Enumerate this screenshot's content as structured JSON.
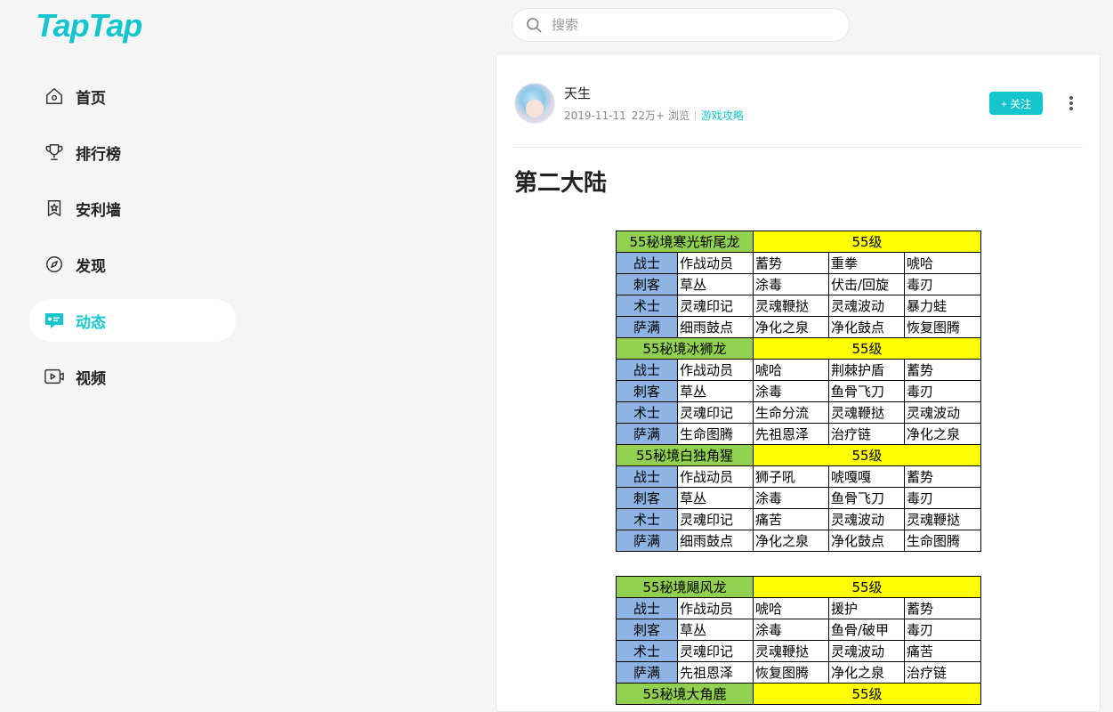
{
  "app": {
    "logo": "TapTap"
  },
  "nav": {
    "items": [
      {
        "label": "首页",
        "icon": "home-icon"
      },
      {
        "label": "排行榜",
        "icon": "trophy-icon"
      },
      {
        "label": "安利墙",
        "icon": "badge-icon"
      },
      {
        "label": "发现",
        "icon": "compass-icon"
      },
      {
        "label": "动态",
        "icon": "message-icon",
        "active": true
      },
      {
        "label": "视频",
        "icon": "video-icon"
      }
    ]
  },
  "search": {
    "placeholder": "搜索"
  },
  "post": {
    "author": "天生",
    "date": "2019-11-11",
    "views": "22万+ 浏览",
    "tag": "游戏攻略",
    "follow_label": "+ 关注",
    "title": "第二大陆"
  },
  "colors": {
    "accent": "#15c5ce",
    "class_cell": "#8db4e2",
    "boss_cell": "#92d050",
    "level_cell": "#ffff00"
  },
  "tables": [
    {
      "rows": [
        {
          "boss": "55秘境寒光斩尾龙",
          "level": "55级"
        },
        {
          "cells": [
            "战士",
            "作战动员",
            "蓄势",
            "重拳",
            "唬哈"
          ]
        },
        {
          "cells": [
            "刺客",
            "草丛",
            "涂毒",
            "伏击/回旋",
            "毒刃"
          ]
        },
        {
          "cells": [
            "术士",
            "灵魂印记",
            "灵魂鞭挞",
            "灵魂波动",
            "暴力蛙"
          ]
        },
        {
          "cells": [
            "萨满",
            "细雨鼓点",
            "净化之泉",
            "净化鼓点",
            "恢复图腾"
          ]
        },
        {
          "boss": "55秘境冰狮龙",
          "level": "55级"
        },
        {
          "cells": [
            "战士",
            "作战动员",
            "唬哈",
            "荆棘护盾",
            "蓄势"
          ]
        },
        {
          "cells": [
            "刺客",
            "草丛",
            "涂毒",
            "鱼骨飞刀",
            "毒刃"
          ]
        },
        {
          "cells": [
            "术士",
            "灵魂印记",
            "生命分流",
            "灵魂鞭挞",
            "灵魂波动"
          ]
        },
        {
          "cells": [
            "萨满",
            "生命图腾",
            "先祖恩泽",
            "治疗链",
            "净化之泉"
          ]
        },
        {
          "boss": "55秘境白独角猩",
          "level": "55级"
        },
        {
          "cells": [
            "战士",
            "作战动员",
            "狮子吼",
            "唬嘎嘎",
            "蓄势"
          ]
        },
        {
          "cells": [
            "刺客",
            "草丛",
            "涂毒",
            "鱼骨飞刀",
            "毒刃"
          ]
        },
        {
          "cells": [
            "术士",
            "灵魂印记",
            "痛苦",
            "灵魂波动",
            "灵魂鞭挞"
          ]
        },
        {
          "cells": [
            "萨满",
            "细雨鼓点",
            "净化之泉",
            "净化鼓点",
            "生命图腾"
          ]
        }
      ]
    },
    {
      "rows": [
        {
          "boss": "55秘境飓风龙",
          "level": "55级"
        },
        {
          "cells": [
            "战士",
            "作战动员",
            "唬哈",
            "援护",
            "蓄势"
          ]
        },
        {
          "cells": [
            "刺客",
            "草丛",
            "涂毒",
            "鱼骨/破甲",
            "毒刃"
          ]
        },
        {
          "cells": [
            "术士",
            "灵魂印记",
            "灵魂鞭挞",
            "灵魂波动",
            "痛苦"
          ]
        },
        {
          "cells": [
            "萨满",
            "先祖恩泽",
            "恢复图腾",
            "净化之泉",
            "治疗链"
          ]
        },
        {
          "boss": "55秘境大角鹿",
          "level": "55级"
        }
      ]
    }
  ]
}
